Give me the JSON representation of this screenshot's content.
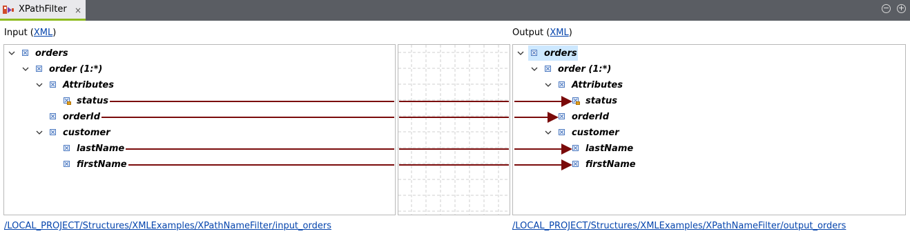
{
  "tab": {
    "title": "XPathFilter",
    "close_glyph": "×",
    "icon": "xpath-filter-icon"
  },
  "window_buttons": {
    "minimize": "−",
    "maximize": "+"
  },
  "input": {
    "label_prefix": "Input (",
    "label_link": "XML",
    "label_suffix": ")",
    "path": "/LOCAL_PROJECT/Structures/XMLExamples/XPathNameFilter/input_orders",
    "tree": [
      {
        "label": "orders",
        "level": 0,
        "expanded": true,
        "kind": "element"
      },
      {
        "label": "order (1:*)",
        "level": 1,
        "expanded": true,
        "kind": "element"
      },
      {
        "label": "Attributes",
        "level": 2,
        "expanded": true,
        "kind": "element"
      },
      {
        "label": "status",
        "level": 3,
        "expanded": null,
        "kind": "attribute"
      },
      {
        "label": "orderId",
        "level": 2,
        "expanded": null,
        "kind": "element"
      },
      {
        "label": "customer",
        "level": 2,
        "expanded": true,
        "kind": "element"
      },
      {
        "label": "lastName",
        "level": 3,
        "expanded": null,
        "kind": "element"
      },
      {
        "label": "firstName",
        "level": 3,
        "expanded": null,
        "kind": "element"
      }
    ]
  },
  "output": {
    "label_prefix": "Output (",
    "label_link": "XML",
    "label_suffix": ")",
    "path": "/LOCAL_PROJECT/Structures/XMLExamples/XPathNameFilter/output_orders",
    "selected": "orders",
    "tree": [
      {
        "label": "orders",
        "level": 0,
        "expanded": true,
        "kind": "element"
      },
      {
        "label": "order (1:*)",
        "level": 1,
        "expanded": true,
        "kind": "element"
      },
      {
        "label": "Attributes",
        "level": 2,
        "expanded": true,
        "kind": "element"
      },
      {
        "label": "status",
        "level": 3,
        "expanded": null,
        "kind": "attribute"
      },
      {
        "label": "orderId",
        "level": 2,
        "expanded": null,
        "kind": "element"
      },
      {
        "label": "customer",
        "level": 2,
        "expanded": true,
        "kind": "element"
      },
      {
        "label": "lastName",
        "level": 3,
        "expanded": null,
        "kind": "element"
      },
      {
        "label": "firstName",
        "level": 3,
        "expanded": null,
        "kind": "element"
      }
    ]
  },
  "mappings": [
    {
      "from": "status",
      "to": "status"
    },
    {
      "from": "orderId",
      "to": "orderId"
    },
    {
      "from": "lastName",
      "to": "lastName"
    },
    {
      "from": "firstName",
      "to": "firstName"
    }
  ],
  "colors": {
    "mapping_line": "#7a0a0a",
    "link": "#0645ad",
    "selection": "#cde8ff",
    "tab_accent": "#8ebb1f"
  }
}
